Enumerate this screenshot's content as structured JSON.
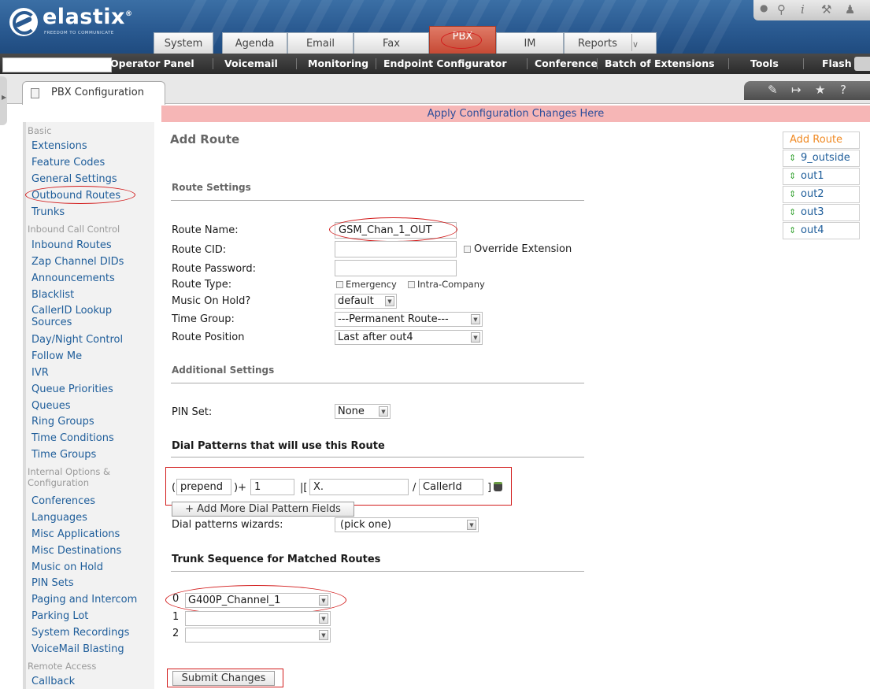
{
  "brand": {
    "name": "elastix",
    "reg": "®",
    "tagline": "FREEDOM TO COMMUNICATE"
  },
  "main_tabs": [
    "System",
    "Agenda",
    "Email",
    "Fax",
    "PBX",
    "IM",
    "Reports"
  ],
  "active_main_tab": "PBX",
  "subnav": [
    "PBX Configuration",
    "Operator Panel",
    "Voicemail",
    "Monitoring",
    "Endpoint Configurator",
    "Conference",
    "Batch of Extensions",
    "Tools",
    "Flash"
  ],
  "window_tab": "PBX Configuration",
  "apply_bar": "Apply Configuration Changes Here",
  "sidebar": {
    "sections": [
      "Basic",
      "Inbound Call Control",
      "Internal Options & Configuration",
      "Remote Access"
    ],
    "basic": [
      "Extensions",
      "Feature Codes",
      "General Settings",
      "Outbound Routes",
      "Trunks"
    ],
    "inbound": [
      "Inbound Routes",
      "Zap Channel DIDs",
      "Announcements",
      "Blacklist",
      "CallerID Lookup Sources",
      "Day/Night Control",
      "Follow Me",
      "IVR",
      "Queue Priorities",
      "Queues",
      "Ring Groups",
      "Time Conditions",
      "Time Groups"
    ],
    "internal": [
      "Conferences",
      "Languages",
      "Misc Applications",
      "Misc Destinations",
      "Music on Hold",
      "PIN Sets",
      "Paging and Intercom",
      "Parking Lot",
      "System Recordings",
      "VoiceMail Blasting"
    ],
    "remote": [
      "Callback"
    ]
  },
  "form": {
    "title": "Add Route",
    "route_settings_header": "Route Settings",
    "labels": {
      "route_name": "Route Name:",
      "route_cid": "Route CID:",
      "route_password": "Route Password:",
      "route_type": "Route Type:",
      "music_on_hold": "Music On Hold?",
      "time_group": "Time Group:",
      "route_position": "Route Position",
      "pin_set": "PIN Set:",
      "dial_wizard": "Dial patterns wizards:"
    },
    "values": {
      "route_name": "GSM_Chan_1_OUT",
      "route_cid": "",
      "route_password": "",
      "music_on_hold": "default",
      "time_group": "---Permanent Route---",
      "route_position": "Last after out4",
      "pin_set": "None",
      "dial_wizard": "(pick one)"
    },
    "override_extension": "Override Extension",
    "route_type_options": [
      "Emergency",
      "Intra-Company"
    ],
    "additional_settings_header": "Additional Settings",
    "dial_patterns_header": "Dial Patterns that will use this Route",
    "dial_pattern": {
      "open_paren": "(",
      "prepend": "prepend",
      "close_plus": ")+",
      "prefix": "1",
      "pipe_bracket": "|[",
      "match": "X.",
      "slash": "/",
      "callerid": "CallerId",
      "close_bracket": "]"
    },
    "add_more_button": "+ Add More Dial Pattern Fields",
    "trunk_sequence_header": "Trunk Sequence for Matched Routes",
    "trunks": [
      {
        "index": "0",
        "value": "G400P_Channel_1"
      },
      {
        "index": "1",
        "value": ""
      },
      {
        "index": "2",
        "value": ""
      }
    ],
    "submit_button": "Submit Changes"
  },
  "route_list": {
    "header": "Add Route",
    "items": [
      "9_outside",
      "out1",
      "out2",
      "out3",
      "out4"
    ]
  },
  "colors": {
    "header_blue": "#2a5a91",
    "active_tab": "#c64a35",
    "link": "#1e5d9a",
    "apply_bar": "#f6b6b6",
    "annotation_red": "#d21b1b",
    "route_header": "#f08a24"
  }
}
